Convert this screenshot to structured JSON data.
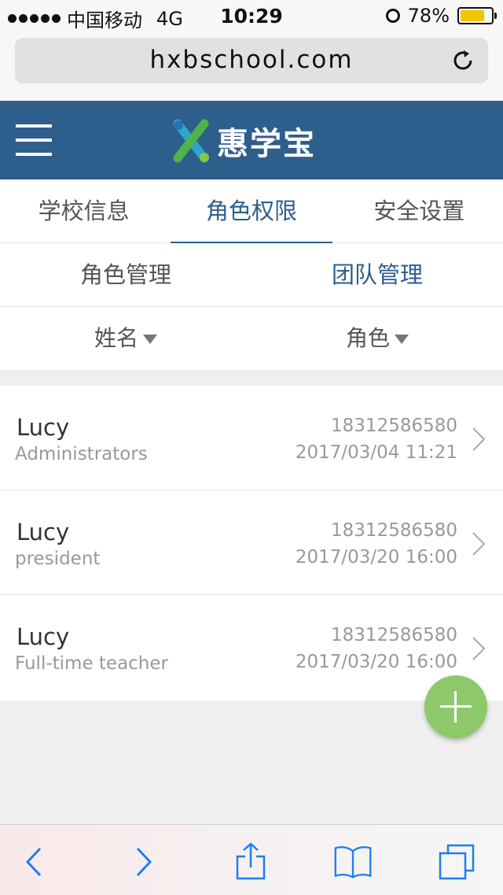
{
  "status_bar": {
    "carrier": "中国移动",
    "network": "4G",
    "time": "10:29",
    "battery": "78%",
    "battery_level": 0.78
  },
  "browser": {
    "url": "hxbschool.com"
  },
  "header": {
    "logo_text": "惠学宝"
  },
  "tabs": [
    {
      "label": "学校信息"
    },
    {
      "label": "角色权限"
    },
    {
      "label": "安全设置"
    }
  ],
  "subtabs": [
    {
      "label": "角色管理"
    },
    {
      "label": "团队管理"
    }
  ],
  "filters": [
    {
      "label": "姓名"
    },
    {
      "label": "角色"
    }
  ],
  "members": [
    {
      "name": "Lucy",
      "role": "Administrators",
      "phone": "18312586580",
      "date": "2017/03/04 11:21"
    },
    {
      "name": "Lucy",
      "role": "president",
      "phone": "18312586580",
      "date": "2017/03/20  16:00"
    },
    {
      "name": "Lucy",
      "role": "Full-time teacher",
      "phone": "18312586580",
      "date": "2017/03/20  16:00"
    }
  ],
  "colors": {
    "header_bg": "#2d5e8c",
    "active_tab": "#2d5e8c",
    "fab": "#8dc96b",
    "toolbar_icons": "#1a7ff2"
  }
}
